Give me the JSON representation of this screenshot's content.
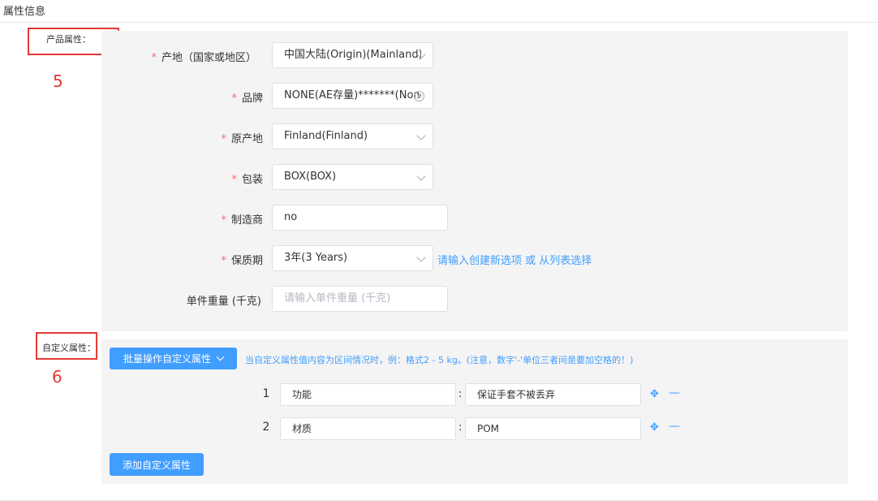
{
  "header": {
    "title": "属性信息"
  },
  "product_group": {
    "label": "产品属性：",
    "annotation_number": "5"
  },
  "custom_group": {
    "label": "自定义属性：",
    "annotation_number": "6"
  },
  "fields": {
    "origin": {
      "label": "产地（国家或地区）",
      "required": "*",
      "value": "中国大陆(Origin)(Mainland)"
    },
    "brand": {
      "label": "品牌",
      "required": "*",
      "value": "NONE(AE存量)*******(None)"
    },
    "place_of_origin": {
      "label": "原产地",
      "required": "*",
      "value": "Finland(Finland)"
    },
    "packaging": {
      "label": "包装",
      "required": "*",
      "value": "BOX(BOX)"
    },
    "manufacturer": {
      "label": "制造商",
      "required": "*",
      "value": "no"
    },
    "shelf_life": {
      "label": "保质期",
      "required": "*",
      "value": "3年(3 Years)",
      "link": "请输入创建新选项 或 从列表选择"
    },
    "unit_weight": {
      "label": "单件重量 (千克)",
      "placeholder": "请输入单件重量 (千克)"
    }
  },
  "custom_attrs": {
    "batch_button": "批量操作自定义属性",
    "hint": "当自定义属性值内容为区间情况时，例：格式2 - 5 kg。(注意，数字'-'单位三者间是要加空格的！)",
    "rows": [
      {
        "index": "1",
        "name": "功能",
        "separator": ":",
        "value": "保证手套不被丢弃"
      },
      {
        "index": "2",
        "name": "材质",
        "separator": ":",
        "value": "POM"
      }
    ],
    "add_button": "添加自定义属性"
  },
  "colors": {
    "primary": "#409eff",
    "required": "#f56c6c",
    "annotation": "#e53935",
    "panel": "#f4f4f4"
  }
}
